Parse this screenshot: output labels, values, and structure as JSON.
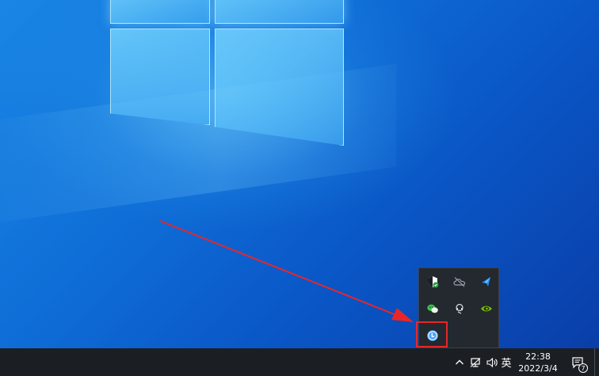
{
  "system_tray": {
    "overflow_icons": [
      {
        "name": "windows-security-icon"
      },
      {
        "name": "onedrive-offline-icon"
      },
      {
        "name": "bluetooth-blue-icon"
      },
      {
        "name": "wechat-icon"
      },
      {
        "name": "headset-app-icon"
      },
      {
        "name": "nvidia-icon"
      },
      {
        "name": "clock-app-icon"
      }
    ],
    "highlighted_icon": "clock-app-icon"
  },
  "taskbar": {
    "ime_label": "英",
    "clock": {
      "time": "22:38",
      "date": "2022/3/4"
    },
    "notification_count": "7"
  },
  "colors": {
    "highlight_border": "#e8262a",
    "arrow": "#e8262a",
    "taskbar_bg": "#1b1f24",
    "flyout_bg": "#23292f"
  }
}
